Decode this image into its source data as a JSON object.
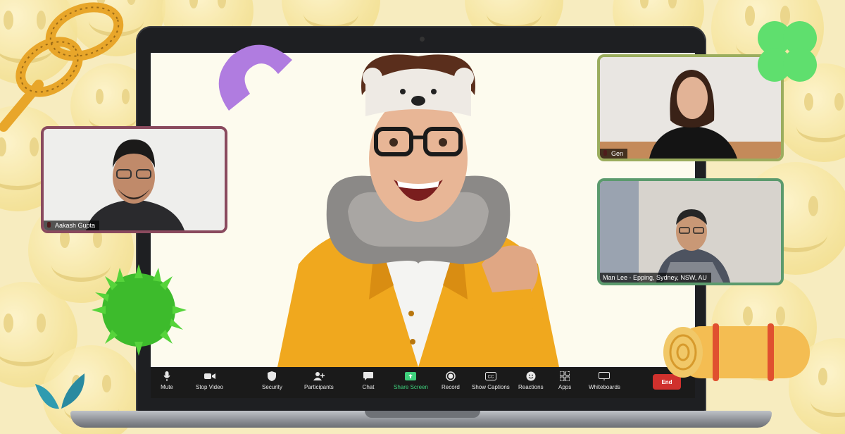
{
  "toolbar": {
    "items": [
      {
        "label": "Mute",
        "icon": "microphone-icon"
      },
      {
        "label": "Stop Video",
        "icon": "video-camera-icon"
      },
      {
        "label": "Security",
        "icon": "shield-icon"
      },
      {
        "label": "Participants",
        "icon": "participants-icon"
      },
      {
        "label": "Chat",
        "icon": "chat-bubble-icon"
      },
      {
        "label": "Share Screen",
        "icon": "share-screen-icon"
      },
      {
        "label": "Record",
        "icon": "record-icon"
      },
      {
        "label": "Show Captions",
        "icon": "captions-icon"
      },
      {
        "label": "Reactions",
        "icon": "reaction-icon"
      },
      {
        "label": "Apps",
        "icon": "apps-icon"
      },
      {
        "label": "Whiteboards",
        "icon": "whiteboard-icon"
      }
    ],
    "end_label": "End"
  },
  "participants": {
    "left": {
      "name": "Aakash Gupta"
    },
    "top_right": {
      "name": "Gen"
    },
    "bottom_right": {
      "name": "Man Lee -  Epping, Sydney, NSW, AU"
    }
  },
  "colors": {
    "share_screen": "#3ed07c",
    "end_button": "#d0312d",
    "tile_left_border": "#8a4a5e",
    "tile_top_right_border": "#9bad5e",
    "tile_bottom_right_border": "#5b9a6d"
  }
}
